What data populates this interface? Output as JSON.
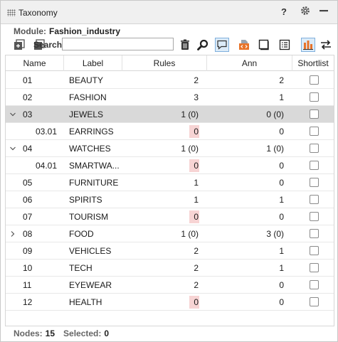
{
  "window": {
    "title": "Taxonomy",
    "help_label": "?"
  },
  "module": {
    "label": "Module:",
    "value": "Fashion_industry"
  },
  "search": {
    "label": "Search:",
    "value": "",
    "placeholder": ""
  },
  "columns": {
    "name": "Name",
    "label": "Label",
    "rules": "Rules",
    "ann": "Ann",
    "shortlist": "Shortlist"
  },
  "rows": [
    {
      "name": "01",
      "label": "BEAUTY",
      "rules": "2",
      "ann": "2",
      "expander": "",
      "indent": 0,
      "selected": false,
      "rules_zero": false,
      "shortlist": false
    },
    {
      "name": "02",
      "label": "FASHION",
      "rules": "3",
      "ann": "1",
      "expander": "",
      "indent": 0,
      "selected": false,
      "rules_zero": false,
      "shortlist": false
    },
    {
      "name": "03",
      "label": "JEWELS",
      "rules": "1 (0)",
      "ann": "0 (0)",
      "expander": "expanded",
      "indent": 0,
      "selected": true,
      "rules_zero": false,
      "shortlist": false
    },
    {
      "name": "03.01",
      "label": "EARRINGS",
      "rules": "0",
      "ann": "0",
      "expander": "",
      "indent": 1,
      "selected": false,
      "rules_zero": true,
      "shortlist": false
    },
    {
      "name": "04",
      "label": "WATCHES",
      "rules": "1 (0)",
      "ann": "1 (0)",
      "expander": "expanded",
      "indent": 0,
      "selected": false,
      "rules_zero": false,
      "shortlist": false
    },
    {
      "name": "04.01",
      "label": "SMARTWA...",
      "rules": "0",
      "ann": "0",
      "expander": "",
      "indent": 1,
      "selected": false,
      "rules_zero": true,
      "shortlist": false
    },
    {
      "name": "05",
      "label": "FURNITURE",
      "rules": "1",
      "ann": "0",
      "expander": "",
      "indent": 0,
      "selected": false,
      "rules_zero": false,
      "shortlist": false
    },
    {
      "name": "06",
      "label": "SPIRITS",
      "rules": "1",
      "ann": "1",
      "expander": "",
      "indent": 0,
      "selected": false,
      "rules_zero": false,
      "shortlist": false
    },
    {
      "name": "07",
      "label": "TOURISM",
      "rules": "0",
      "ann": "0",
      "expander": "",
      "indent": 0,
      "selected": false,
      "rules_zero": true,
      "shortlist": false
    },
    {
      "name": "08",
      "label": "FOOD",
      "rules": "1 (0)",
      "ann": "3 (0)",
      "expander": "collapsed",
      "indent": 0,
      "selected": false,
      "rules_zero": false,
      "shortlist": false
    },
    {
      "name": "09",
      "label": "VEHICLES",
      "rules": "2",
      "ann": "1",
      "expander": "",
      "indent": 0,
      "selected": false,
      "rules_zero": false,
      "shortlist": false
    },
    {
      "name": "10",
      "label": "TECH",
      "rules": "2",
      "ann": "1",
      "expander": "",
      "indent": 0,
      "selected": false,
      "rules_zero": false,
      "shortlist": false
    },
    {
      "name": "11",
      "label": "EYEWEAR",
      "rules": "2",
      "ann": "0",
      "expander": "",
      "indent": 0,
      "selected": false,
      "rules_zero": false,
      "shortlist": false
    },
    {
      "name": "12",
      "label": "HEALTH",
      "rules": "0",
      "ann": "0",
      "expander": "",
      "indent": 0,
      "selected": false,
      "rules_zero": true,
      "shortlist": false
    }
  ],
  "status": {
    "nodes_label": "Nodes:",
    "nodes_value": "15",
    "selected_label": "Selected:",
    "selected_value": "0"
  },
  "colors": {
    "selected_row": "#d9d9d9",
    "zero_highlight": "#f7d4d4",
    "accent_orange": "#e8732a",
    "toggle_active": "#dcebf8"
  },
  "icons": [
    "grip-icon",
    "help-icon",
    "gear-icon",
    "minimize-icon",
    "add-node-icon",
    "copy-icon",
    "trash-icon",
    "search-icon",
    "comment-icon",
    "code-icon",
    "window-icon",
    "list-icon",
    "bar-chart-icon",
    "swap-icon",
    "chevron-down-icon",
    "chevron-right-icon"
  ]
}
